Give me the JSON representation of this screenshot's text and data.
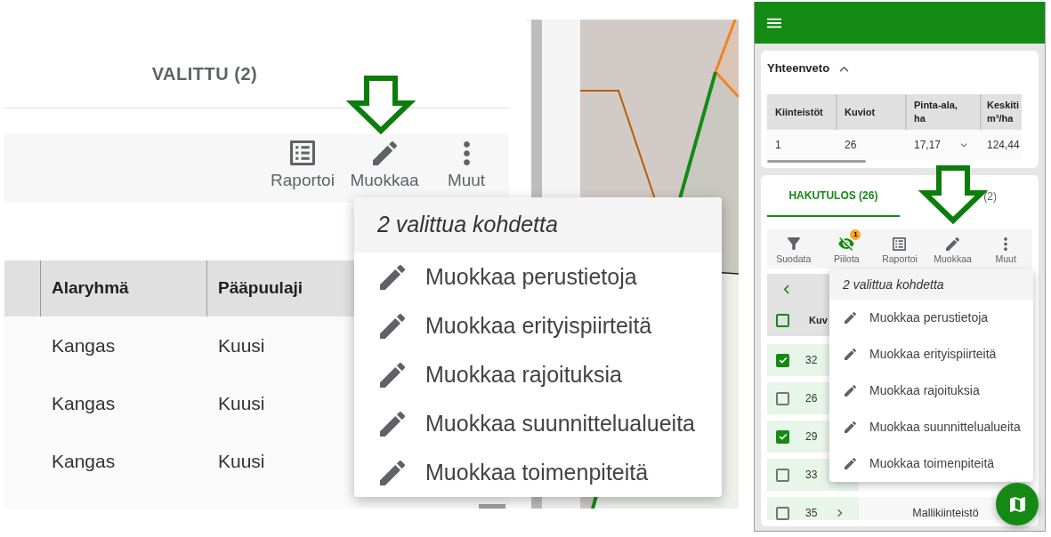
{
  "left_view": {
    "tab": {
      "label": "VALITTU (2)",
      "selected": false
    },
    "toolbar": [
      {
        "kind": "report",
        "label": "Raportoi"
      },
      {
        "kind": "edit",
        "label": "Muokkaa"
      },
      {
        "kind": "more",
        "label": "Muut"
      }
    ],
    "table": {
      "columns": [
        "Alaryhmä",
        "Pääpuulaji"
      ],
      "rows": [
        [
          "Kangas",
          "Kuusi"
        ],
        [
          "Kangas",
          "Kuusi"
        ],
        [
          "Kangas",
          "Kuusi"
        ]
      ]
    },
    "menu": {
      "header": "2 valittua kohdetta",
      "items": [
        "Muokkaa perustietoja",
        "Muokkaa erityispiirteitä",
        "Muokkaa rajoituksia",
        "Muokkaa suunnittelualueita",
        "Muokkaa toimenpiteitä"
      ]
    }
  },
  "right_view": {
    "summary": {
      "title": "Yhteenveto",
      "expanded": true,
      "columns": [
        "Kiinteistöt",
        "Kuviot",
        "Pinta-ala, ha",
        "Keskiti m³/ha"
      ],
      "rows": [
        [
          "1",
          "26",
          "17,17",
          "124,44"
        ]
      ]
    },
    "results": {
      "tabs": [
        {
          "label": "HAKUTULOS (26)",
          "selected": true
        },
        {
          "label": "(2)",
          "selected": false
        }
      ],
      "toolbar": [
        {
          "kind": "filter",
          "label": "Suodata",
          "active": false
        },
        {
          "kind": "hide",
          "label": "Piilota",
          "active": true,
          "badge": "1"
        },
        {
          "kind": "report",
          "label": "Raportoi",
          "active": false
        },
        {
          "kind": "edit",
          "label": "Muokkaa",
          "active": false
        },
        {
          "kind": "more",
          "label": "Muut",
          "active": false
        }
      ],
      "select_all": {
        "checked": false
      },
      "column": "Kuv",
      "rows": [
        {
          "checked": true,
          "value": "32"
        },
        {
          "checked": false,
          "value": "26"
        },
        {
          "checked": true,
          "value": "29"
        },
        {
          "checked": false,
          "value": "33"
        },
        {
          "checked": false,
          "value": "35",
          "owner": "Mallikiinteistö"
        }
      ],
      "menu": {
        "header": "2 valittua kohdetta",
        "items": [
          "Muokkaa perustietoja",
          "Muokkaa erityispiirteitä",
          "Muokkaa rajoituksia",
          "Muokkaa suunnittelualueita",
          "Muokkaa toimenpiteitä"
        ]
      }
    }
  }
}
